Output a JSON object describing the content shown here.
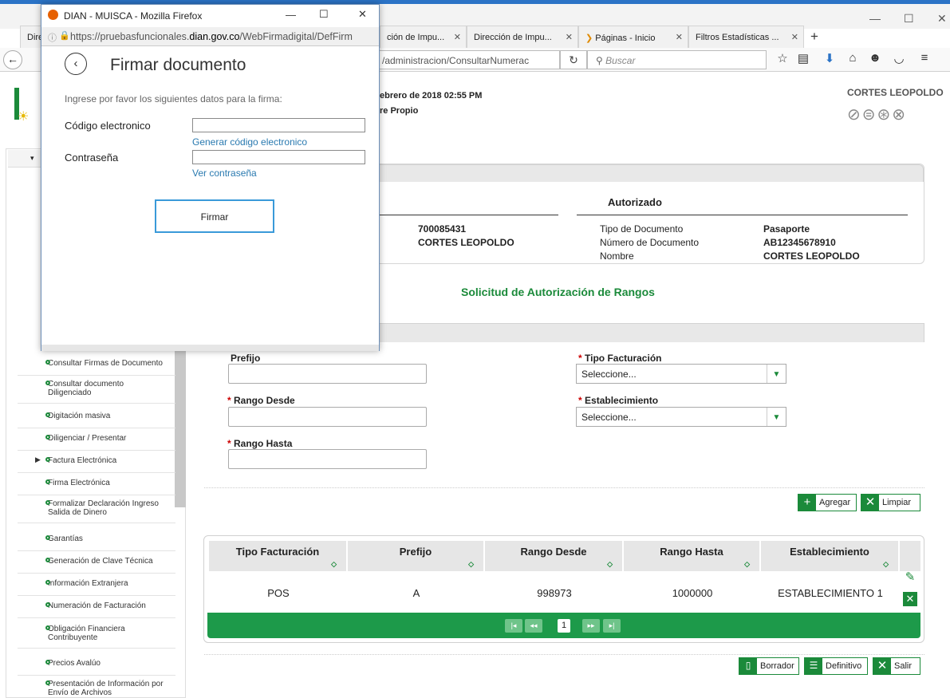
{
  "browser": {
    "tabs": [
      {
        "label": "Dire"
      },
      {
        "label": "ción de Impu..."
      },
      {
        "label": "Dirección de Impu..."
      },
      {
        "label": "Páginas - Inicio"
      },
      {
        "label": "Filtros Estadísticas ..."
      }
    ],
    "new_tab": "+",
    "url_partial": "/administracion/ConsultarNumerac",
    "search_placeholder": "Buscar"
  },
  "dialog": {
    "window_title": "DIAN - MUISCA - Mozilla Firefox",
    "url_prefix": "https://pruebasfuncionales.",
    "url_domain": "dian.gov.co",
    "url_suffix": "/WebFirmadigital/DefFirm",
    "heading": "Firmar documento",
    "instructions": "Ingrese por favor los siguientes datos para la firma:",
    "code_label": "Código electronico",
    "code_link": "Generar código electronico",
    "password_label": "Contraseña",
    "password_link": "Ver contraseña",
    "sign_button": "Firmar"
  },
  "header": {
    "date_fragment": "ebrero de 2018 02:55 PM",
    "role_fragment": "re Propio",
    "user_name": "CORTES LEOPOLDO"
  },
  "info": {
    "id_number": "700085431",
    "id_name": "CORTES LEOPOLDO",
    "authorized_title": "Autorizado",
    "doc_type_label": "Tipo de Documento",
    "doc_type_value": "Pasaporte",
    "doc_number_label": "Número de Documento",
    "doc_number_value": "AB12345678910",
    "name_label": "Nombre",
    "name_value": "CORTES LEOPOLDO"
  },
  "form": {
    "section_title": "Solicitud de Autorización de Rangos",
    "prefijo_label": "Prefijo",
    "rango_desde_label": "Rango Desde",
    "rango_hasta_label": "Rango Hasta",
    "tipo_facturacion_label": "Tipo Facturación",
    "tipo_facturacion_value": "Seleccione...",
    "establecimiento_label": "Establecimiento",
    "establecimiento_value": "Seleccione...",
    "required_mark": "*",
    "add_button": "Agregar",
    "clear_button": "Limpiar"
  },
  "grid": {
    "columns": [
      "Tipo Facturación",
      "Prefijo",
      "Rango Desde",
      "Rango Hasta",
      "Establecimiento"
    ],
    "rows": [
      {
        "tipo": "POS",
        "prefijo": "A",
        "desde": "998973",
        "hasta": "1000000",
        "establecimiento": "ESTABLECIMIENTO 1"
      }
    ],
    "current_page": "1"
  },
  "footer_buttons": {
    "draft": "Borrador",
    "final": "Definitivo",
    "exit": "Salir"
  },
  "sidebar": {
    "items": [
      {
        "label": "Consultar Firmas de Documento"
      },
      {
        "label": "Consultar documento\nDiligenciado"
      },
      {
        "label": "Digitación masiva"
      },
      {
        "label": "Diligenciar / Presentar"
      },
      {
        "label": "Factura Electrónica"
      },
      {
        "label": "Firma Electrónica"
      },
      {
        "label": "Formalizar Declaración Ingreso\nSalida de Dinero"
      },
      {
        "label": "Garantías"
      },
      {
        "label": "Generación de Clave Técnica"
      },
      {
        "label": "Información Extranjera"
      },
      {
        "label": "Numeración de Facturación"
      },
      {
        "label": "Obligación Financiera\nContribuyente"
      },
      {
        "label": "Precios Avalúo"
      },
      {
        "label": "Presentación de Información por\nEnvío de Archivos"
      }
    ]
  },
  "colors": {
    "accent_green": "#1b8a3a",
    "heading_green": "#1b8a3a",
    "pager_green": "#1d9a4a",
    "firefox_blue": "#2b73c6"
  }
}
